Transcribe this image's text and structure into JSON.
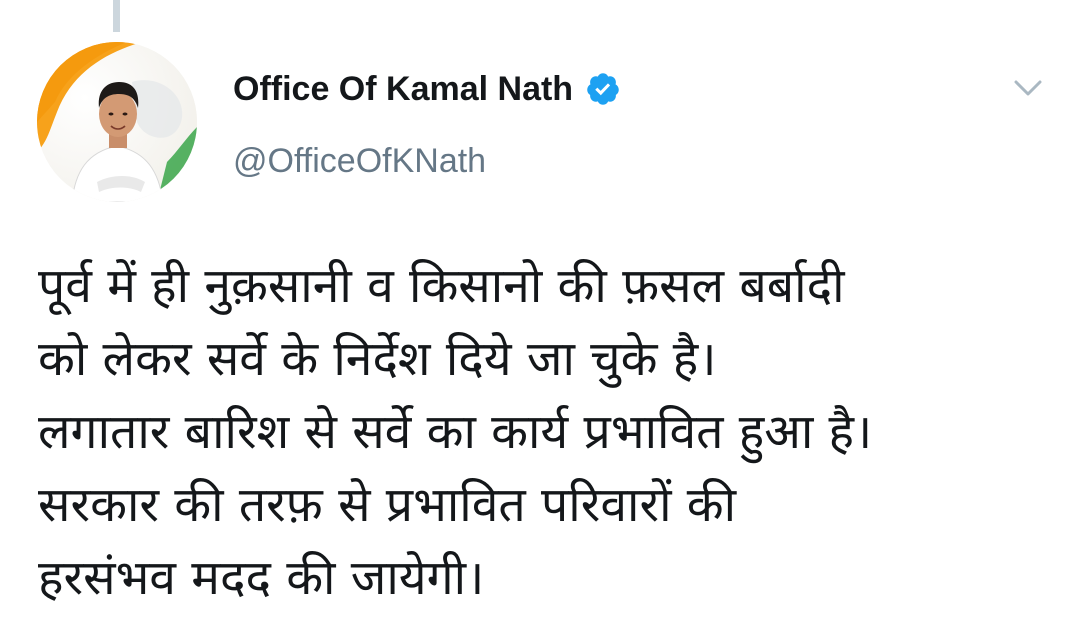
{
  "tweet": {
    "author": {
      "display_name": "Office Of Kamal Nath",
      "handle": "@OfficeOfKNath",
      "verified": true,
      "verified_icon": "verified-badge-icon",
      "avatar_icon": "profile-photo"
    },
    "menu_icon": "chevron-down-icon",
    "text_lines": [
      "पूर्व में ही नुक़सानी व किसानो की फ़सल बर्बादी",
      "को लेकर सर्वे के निर्देश दिये जा चुके है।",
      "लगातार बारिश से सर्वे का कार्य प्रभावित हुआ है।",
      "सरकार की तरफ़ से प्रभावित परिवारों की",
      "हरसंभव मदद की जायेगी।"
    ]
  },
  "colors": {
    "text_primary": "#14171a",
    "text_secondary": "#657786",
    "verified_blue": "#1da1f2",
    "chevron_gray": "#aab8c2",
    "thread_line": "#ccd6dd",
    "avatar_saffron": "#f7a21b",
    "avatar_green": "#2e9b3c"
  }
}
